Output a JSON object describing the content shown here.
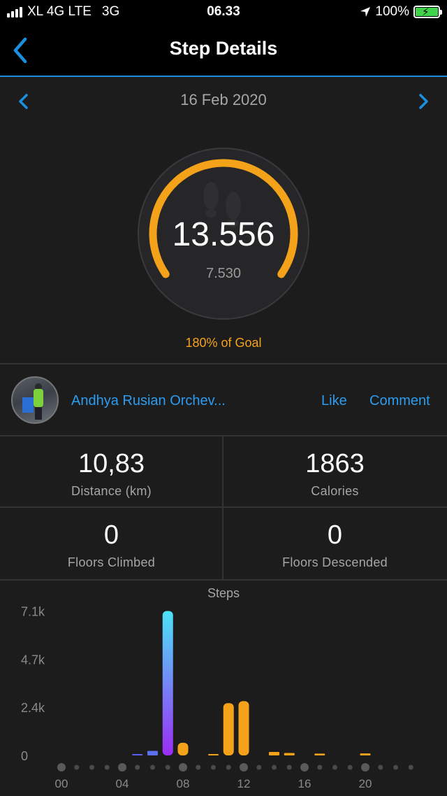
{
  "status_bar": {
    "carrier": "XL 4G LTE",
    "network": "3G",
    "time": "06.33",
    "battery": "100%",
    "battery_color": "#3fd24a"
  },
  "nav": {
    "title": "Step Details",
    "back_icon": "chevron-left-icon",
    "accent_color": "#1b8fdf"
  },
  "date_nav": {
    "date": "16 Feb 2020",
    "prev_icon": "chevron-left-icon",
    "next_icon": "chevron-right-icon"
  },
  "progress": {
    "steps": "13.556",
    "goal": "7.530",
    "goal_percent_label": "180% of Goal",
    "fraction_of_ring": 1.0,
    "ring_color": "#f5a21b",
    "icon": "footprints-icon"
  },
  "social": {
    "user_name": "Andhya Rusian Orchev...",
    "like_label": "Like",
    "comment_label": "Comment"
  },
  "stats": [
    {
      "value": "10,83",
      "label": "Distance (km)"
    },
    {
      "value": "1863",
      "label": "Calories"
    },
    {
      "value": "0",
      "label": "Floors Climbed"
    },
    {
      "value": "0",
      "label": "Floors Descended"
    }
  ],
  "chart_data": {
    "type": "bar",
    "title": "Steps",
    "xlabel": "",
    "ylabel": "",
    "y_tick_labels": [
      "0",
      "2.4k",
      "4.7k",
      "7.1k"
    ],
    "y_ticks": [
      0,
      2350,
      4700,
      7050
    ],
    "ylim": [
      0,
      7100
    ],
    "x_tick_labels": [
      "00",
      "04",
      "08",
      "12",
      "16",
      "20"
    ],
    "x_ticks": [
      0,
      4,
      8,
      12,
      16,
      20
    ],
    "x": [
      0,
      1,
      2,
      3,
      4,
      5,
      6,
      7,
      8,
      9,
      10,
      11,
      12,
      13,
      14,
      15,
      16,
      17,
      18,
      19,
      20,
      21,
      22,
      23
    ],
    "values": [
      0,
      0,
      0,
      0,
      0,
      40,
      220,
      7050,
      620,
      0,
      40,
      2550,
      2650,
      0,
      170,
      120,
      0,
      90,
      0,
      0,
      100,
      0,
      0,
      0
    ],
    "colors": [
      "#f5a21b",
      "#f5a21b",
      "#f5a21b",
      "#f5a21b",
      "#f5a21b",
      "#5b5ff0",
      "#5b6ff0",
      "gradient",
      "#f5a21b",
      "#f5a21b",
      "#f5a21b",
      "#f5a21b",
      "#f5a21b",
      "#f5a21b",
      "#f5a21b",
      "#f5a21b",
      "#f5a21b",
      "#f5a21b",
      "#f5a21b",
      "#f5a21b",
      "#f5a21b",
      "#f5a21b",
      "#f5a21b",
      "#f5a21b"
    ],
    "gradient": [
      "#9b2cf5",
      "#4ce3f7"
    ],
    "grid": false
  }
}
